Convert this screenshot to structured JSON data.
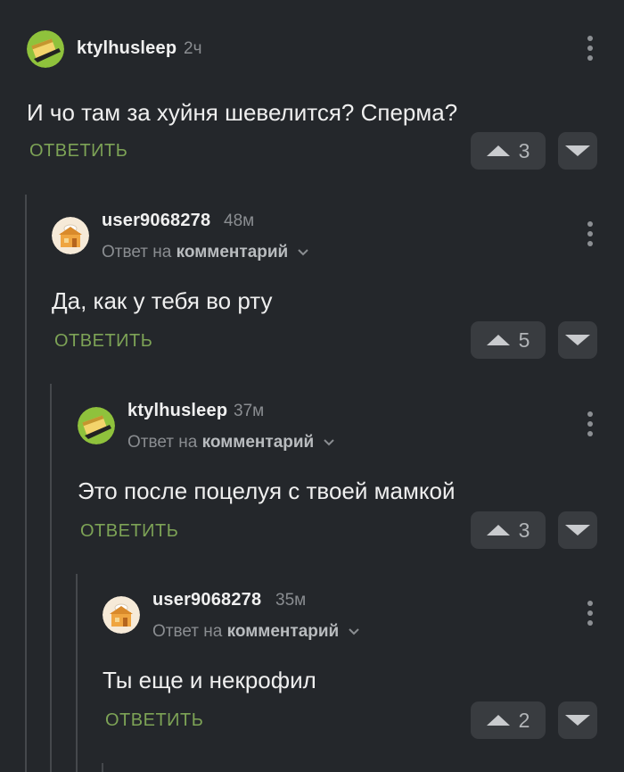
{
  "comments": [
    {
      "username": "ktylhusleep",
      "time": "2ч",
      "reply_prefix": "",
      "reply_target": "",
      "text": "И чо там за хуйня шевелится? Сперма?",
      "reply_label": "ОТВЕТИТЬ",
      "votes": "3",
      "avatar": "sponge-avatar"
    },
    {
      "username": "user9068278",
      "time": "48м",
      "reply_prefix": "Ответ на",
      "reply_target": "комментарий",
      "text": "Да, как у тебя во рту",
      "reply_label": "ОТВЕТИТЬ",
      "votes": "5",
      "avatar": "house-avatar"
    },
    {
      "username": "ktylhusleep",
      "time": "37м",
      "reply_prefix": "Ответ на",
      "reply_target": "комментарий",
      "text": "Это после поцелуя с твоей мамкой",
      "reply_label": "ОТВЕТИТЬ",
      "votes": "3",
      "avatar": "sponge-avatar"
    },
    {
      "username": "user9068278",
      "time": "35м",
      "reply_prefix": "Ответ на",
      "reply_target": "комментарий",
      "text": "Ты еще и некрофил",
      "reply_label": "ОТВЕТИТЬ",
      "votes": "2",
      "avatar": "house-avatar"
    }
  ],
  "colors": {
    "background": "#24272b",
    "reply_green": "#7da356",
    "vote_bg": "#393c40"
  }
}
